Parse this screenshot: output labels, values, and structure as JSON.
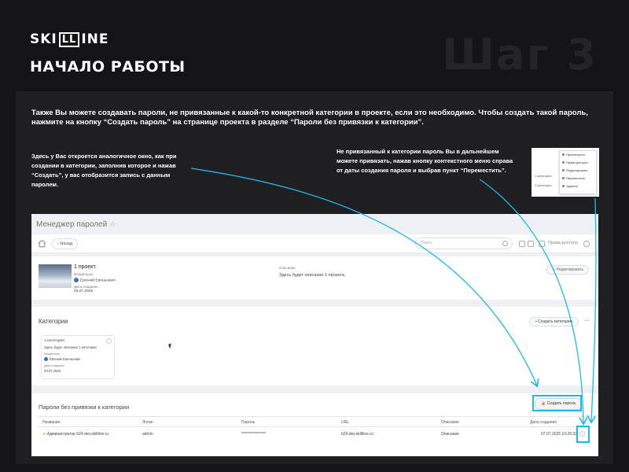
{
  "header": {
    "logo_left": "SKI",
    "logo_box": "LL",
    "logo_right": "INE",
    "title": "НАЧАЛО РАБОТЫ",
    "step": "Шаг 3"
  },
  "intro": "Также Вы можете создавать пароли, не привязанные к какой-то конкретной категории в проекте, если это необходимо. Чтобы создать такой пароль, нажмите на кнопку “Создать пароль” на странице проекта в разделе “Пароли без привязки к категории”.",
  "note_left": "Здесь у Вас откроется аналогичное окно, как при создании в категории, заполнив которое и нажав “Создать”, у вас отобразится запись с данным паролем.",
  "note_right": "Не привязанный к категории пароль Вы в дальнейшем можете привязать, нажав кнопку контекстного меню справа от даты создания пароля и выбрав пункт “Переместить”.",
  "thumbnail": {
    "cat1": "1 категория",
    "cat2": "2 категория",
    "menu": [
      "Просмотреть",
      "Права доступа",
      "Редактировать",
      "Переместить",
      "Удалить"
    ]
  },
  "app": {
    "title": "Менеджер паролей",
    "back": "Назад",
    "search_placeholder": "Поиск",
    "access_rights": "Права доступа",
    "project": {
      "name": "1 проект.",
      "owners_label": "Владельцы",
      "owner": "Евгений Евгеньевич",
      "created_label": "Дата создания",
      "created": "03.07.2025",
      "desc_label": "Описание",
      "desc": "Здесь будет описание 1 проекта.",
      "edit": "Редактировать"
    },
    "categories": {
      "title": "Категории",
      "create": "Создать категорию",
      "item": {
        "name": "1 категория",
        "desc": "Здесь будет описание 1 категории",
        "owners_label": "Владельцы",
        "owner": "Евгений Евгеньевич",
        "created_label": "Дата создания",
        "created": "03.07.2025"
      }
    },
    "passwords": {
      "title": "Пароли без привязки к категории",
      "create": "Создать пароль",
      "columns": [
        "Название",
        "Логин",
        "Пароль",
        "URL",
        "Описание",
        "Дата создания"
      ],
      "row": {
        "name": "Администратор b24.dev.skillline.ru",
        "login": "admin",
        "password": "****************",
        "url": "b24.dev.skillline.ru",
        "desc": "Описание",
        "created": "07.07.2025 10:29:32"
      }
    }
  },
  "colors": {
    "accent": "#21b8e8",
    "background": "#141416",
    "panel": "#1f1f22"
  }
}
